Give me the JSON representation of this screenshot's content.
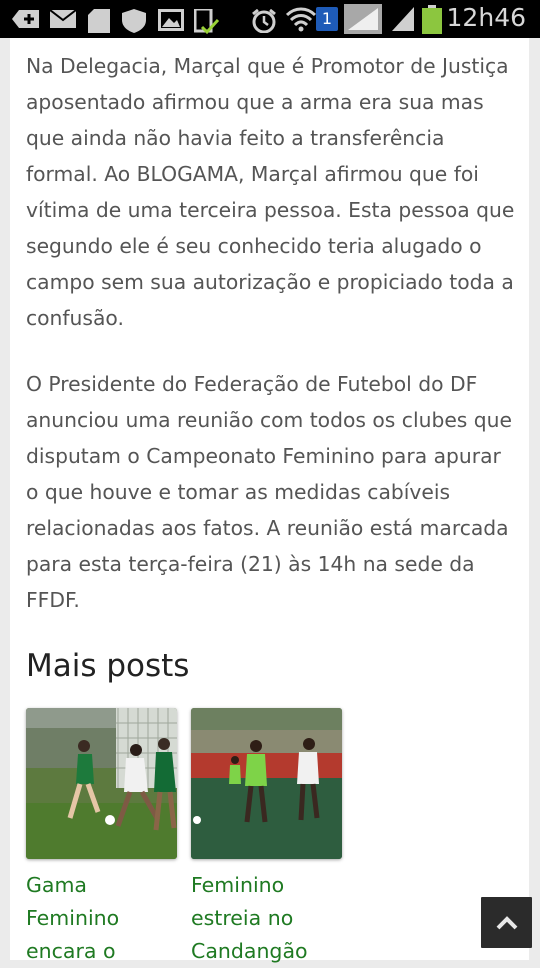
{
  "status_bar": {
    "time": "12h46",
    "sim_badge": "1",
    "icons": [
      "add-icon",
      "message-icon",
      "sd-card-icon",
      "shield-icon",
      "image-icon",
      "download-done-icon",
      "alarm-icon",
      "wifi-icon",
      "sim-badge-icon",
      "signal-icon",
      "signal-icon-2",
      "battery-icon"
    ]
  },
  "article": {
    "paragraphs": [
      "Na Delegacia, Marçal que é Promotor de Justiça aposentado afirmou que a arma era sua mas que ainda não havia feito a transferência formal.  Ao BLOGAMA, Marçal afirmou que foi vítima de uma terceira pessoa. Esta pessoa que segundo ele é seu conhecido teria alugado o campo sem sua autorização e propiciado toda a confusão.",
      "O Presidente do Federação de Futebol do DF anunciou uma reunião com todos os clubes que disputam o Campeonato Feminino para apurar o que houve e tomar as medidas cabíveis relacionadas aos fatos. A reunião está marcada para esta terça-feira (21) às 14h na sede da FFDF."
    ]
  },
  "more_posts": {
    "title": "Mais posts",
    "posts": [
      {
        "title": "Gama Feminino encara o"
      },
      {
        "title": "Feminino estreia no Candangão"
      }
    ]
  },
  "colors": {
    "link": "#1f7a22",
    "text": "#555555",
    "status_bar": "#000000",
    "scroll_button": "#2b2b2b"
  }
}
